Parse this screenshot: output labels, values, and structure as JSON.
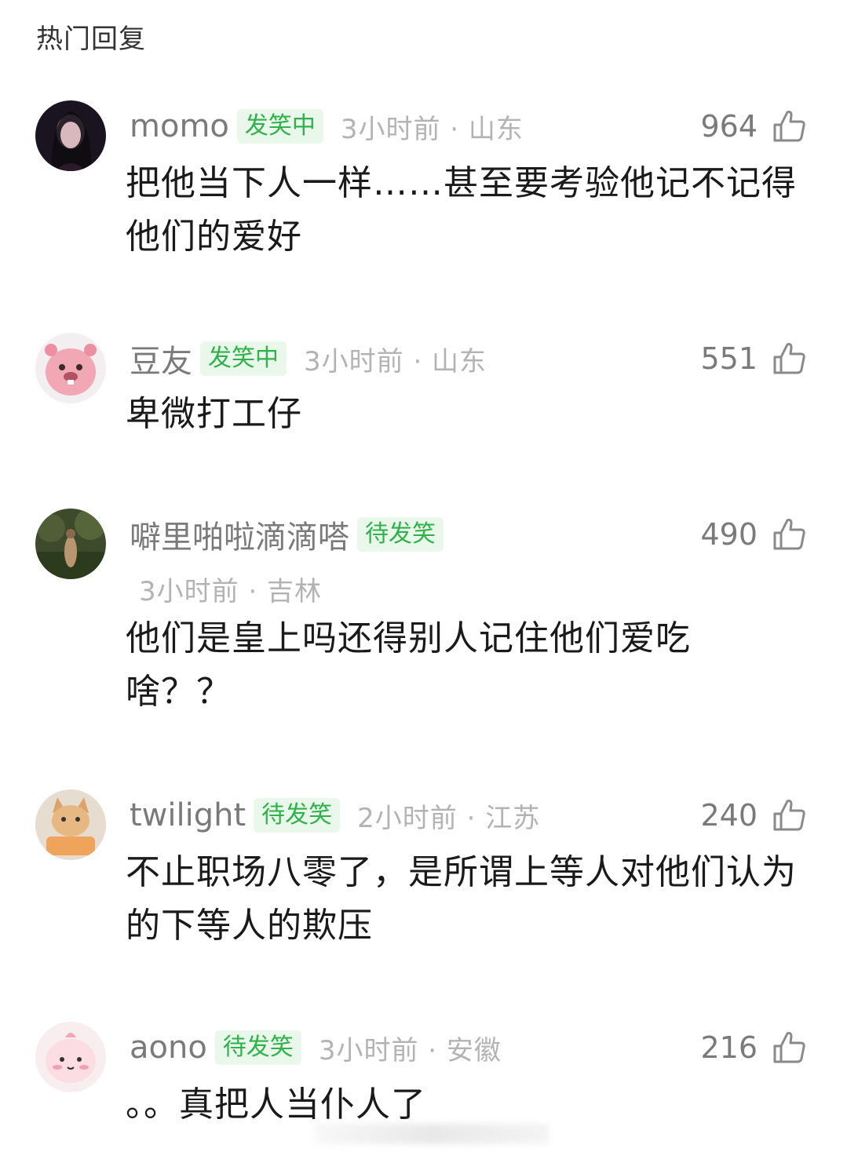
{
  "section_title": "热门回复",
  "comments": [
    {
      "username": "momo",
      "badge": "发笑中",
      "time_location": "3小时前 · 山东",
      "likes": "964",
      "text": "把他当下人一样……甚至要考验他记不记得他们的爱好",
      "avatar_icon": "avatar-dark-portrait-icon"
    },
    {
      "username": "豆友",
      "badge": "发笑中",
      "time_location": "3小时前 · 山东",
      "likes": "551",
      "text": "卑微打工仔",
      "avatar_icon": "avatar-pink-beaver-icon"
    },
    {
      "username": "噼里啪啦滴滴嗒",
      "badge": "待发笑",
      "time_location": "3小时前 · 吉林",
      "likes": "490",
      "text": "他们是皇上吗还得别人记住他们爱吃啥？？",
      "avatar_icon": "avatar-forest-figure-icon"
    },
    {
      "username": "twilight",
      "badge": "待发笑",
      "time_location": "2小时前 · 江苏",
      "likes": "240",
      "text": "不止职场八零了，是所谓上等人对他们认为的下等人的欺压",
      "avatar_icon": "avatar-cat-icon"
    },
    {
      "username": "aono",
      "badge": "待发笑",
      "time_location": "3小时前 · 安徽",
      "likes": "216",
      "text": "。。真把人当仆人了",
      "avatar_icon": "avatar-pink-blob-icon"
    }
  ]
}
